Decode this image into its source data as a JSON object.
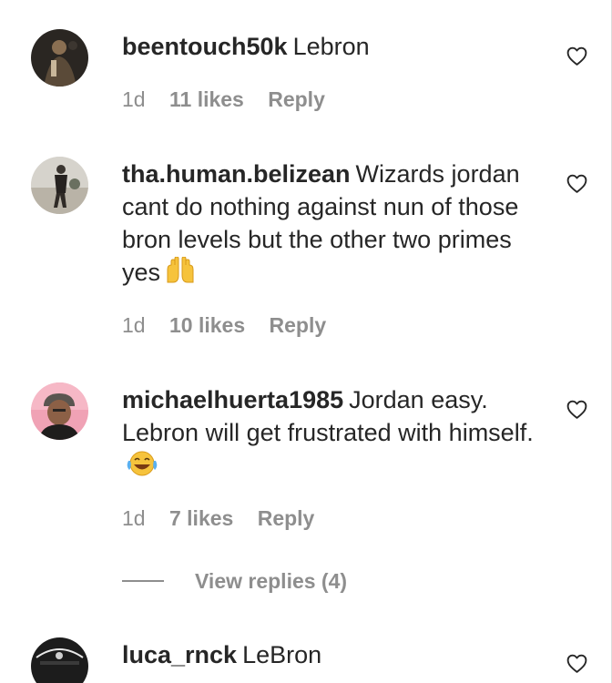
{
  "comments": [
    {
      "username": "beentouch50k",
      "text": "Lebron",
      "time": "1d",
      "likes": "11 likes",
      "reply": "Reply",
      "avatar_icon": "avatar-photo-icon",
      "like_icon": "heart-outline-icon"
    },
    {
      "username": "tha.human.belizean",
      "text": "Wizards jordan cant do nothing against nun of those bron levels but the other two primes yes",
      "emoji": "🙌",
      "time": "1d",
      "likes": "10 likes",
      "reply": "Reply",
      "avatar_icon": "avatar-photo-icon",
      "like_icon": "heart-outline-icon"
    },
    {
      "username": "michaelhuerta1985",
      "text": "Jordan easy. Lebron will get frustrated with himself.",
      "emoji": "😂",
      "time": "1d",
      "likes": "7 likes",
      "reply": "Reply",
      "view_replies": "View replies (4)",
      "avatar_icon": "avatar-photo-icon",
      "like_icon": "heart-outline-icon"
    },
    {
      "username": "luca_rnck",
      "text": "LeBron",
      "avatar_icon": "avatar-photo-icon",
      "like_icon": "heart-outline-icon"
    }
  ],
  "colors": {
    "text": "#262626",
    "secondary": "#8e8e8e",
    "background": "#ffffff"
  }
}
